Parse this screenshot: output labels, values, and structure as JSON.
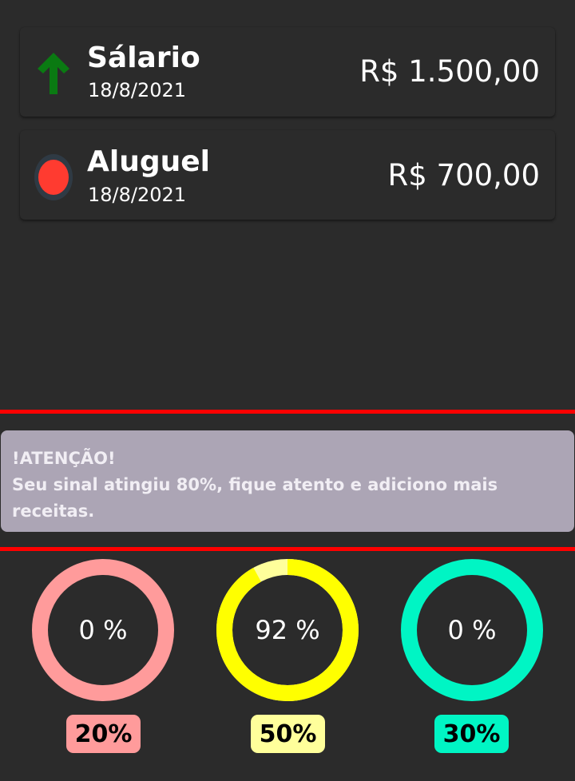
{
  "transactions": [
    {
      "title": "Sálario",
      "date": "18/8/2021",
      "amount": "R$ 1.500,00",
      "icon": "arrow-up-icon",
      "icon_color": "#0a7a12"
    },
    {
      "title": "Aluguel",
      "date": "18/8/2021",
      "amount": "R$ 700,00",
      "icon": "red-dot-icon",
      "icon_color": "#ff3b30"
    }
  ],
  "alert": {
    "title": "!ATENÇÃO!",
    "message": "Seu sinal atingiu 80%, fique atento e adiciono mais receitas.",
    "background": "#aca5b5",
    "divider_color": "#ff0000"
  },
  "gauges": [
    {
      "value_label": "0 %",
      "progress": 0,
      "color": "#ff9b9b",
      "badge": "20%"
    },
    {
      "value_label": "92 %",
      "progress": 0.92,
      "color": "#ffff00",
      "remainder_color": "#ffff9b",
      "badge": "50%"
    },
    {
      "value_label": "0 %",
      "progress": 0,
      "color": "#00f5c4",
      "badge": "30%"
    }
  ]
}
